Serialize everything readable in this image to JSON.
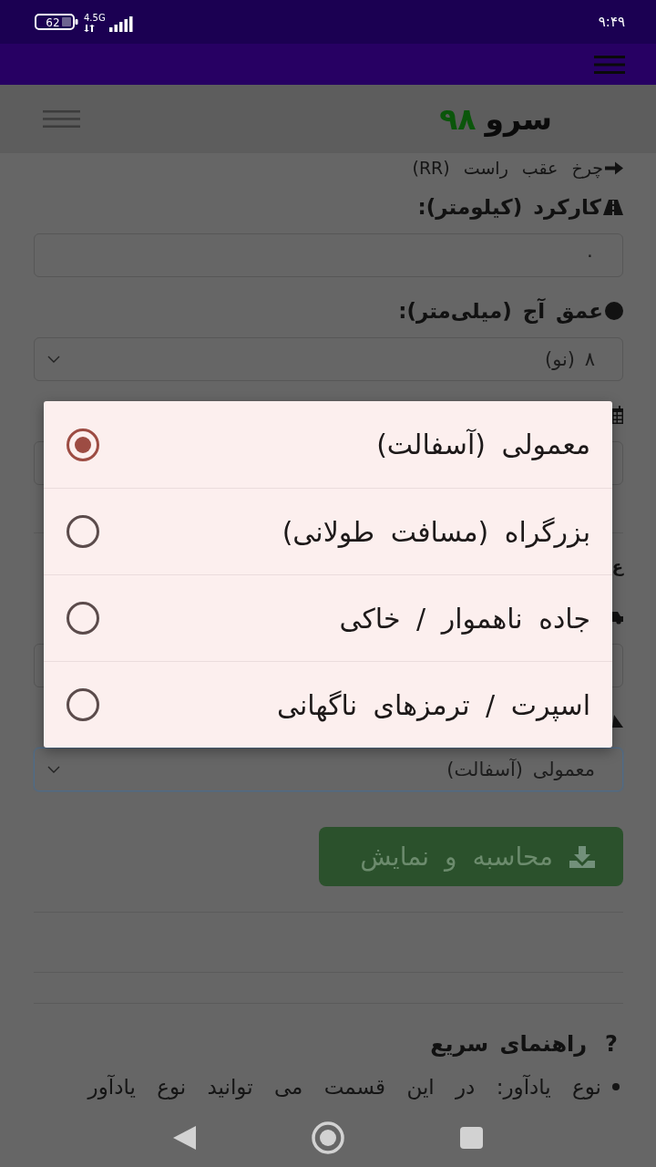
{
  "status_bar": {
    "battery": "62",
    "network": "4.5G",
    "time": "۹:۴۹"
  },
  "header": {
    "logo_name": "سرو",
    "logo_number": "۹۸"
  },
  "form": {
    "rows": [
      {
        "kind": "caption",
        "text": "چرخ عقب راست (RR)"
      },
      {
        "kind": "label",
        "text": "کارکرد (کیلومتر):"
      },
      {
        "kind": "input",
        "value": "۰",
        "focused": false
      },
      {
        "kind": "label",
        "text": "عمق آج (میلی‌متر):"
      },
      {
        "kind": "select",
        "value": "۸ (نو)",
        "focused": false
      },
      {
        "kind": "label"
      },
      {
        "kind": "input",
        "focused": false
      },
      {
        "kind": "divider"
      },
      {
        "kind": "heading",
        "text": "ع"
      },
      {
        "kind": "label"
      },
      {
        "kind": "select",
        "focused": false
      },
      {
        "kind": "label"
      },
      {
        "kind": "select",
        "value": "معمولی (آسفالت)",
        "focused": true
      }
    ]
  },
  "submit_button": {
    "label": "محاسبه و نمایش"
  },
  "help": {
    "mark": "?",
    "title": "راهنمای سریع",
    "items": [
      "نوع یادآور: در این قسمت می توانید نوع یادآور"
    ]
  },
  "choice_dialog": {
    "options": [
      {
        "label": "معمولی (آسفالت)",
        "selected": true
      },
      {
        "label": "بزرگراه (مسافت طولانی)",
        "selected": false
      },
      {
        "label": "جاده ناهموار / خاکی",
        "selected": false
      },
      {
        "label": "اسپرت / ترمزهای ناگهانی",
        "selected": false
      }
    ]
  }
}
